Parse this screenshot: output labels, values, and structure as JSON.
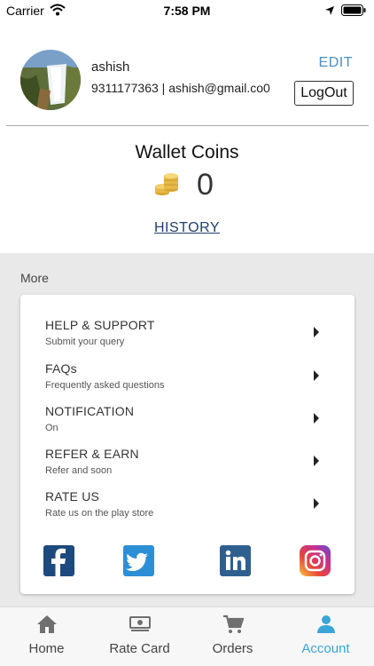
{
  "status_bar": {
    "carrier": "Carrier",
    "time": "7:58 PM"
  },
  "profile": {
    "name": "ashish",
    "contact": "9311177363 | ashish@gmail.co0",
    "edit_label": "EDIT",
    "logout_label": "LogOut"
  },
  "wallet": {
    "title": "Wallet Coins",
    "value": "0",
    "history_label": "HISTORY"
  },
  "more": {
    "label": "More",
    "items": [
      {
        "title": "HELP & SUPPORT",
        "subtitle": "Submit your query"
      },
      {
        "title": "FAQs",
        "subtitle": "Frequently asked questions"
      },
      {
        "title": "NOTIFICATION",
        "subtitle": "On"
      },
      {
        "title": "REFER & EARN",
        "subtitle": "Refer and soon"
      },
      {
        "title": "RATE US",
        "subtitle": "Rate us on the play store"
      }
    ],
    "social": [
      "facebook-icon",
      "twitter-icon",
      "linkedin-icon",
      "instagram-icon"
    ]
  },
  "tabs": [
    {
      "label": "Home",
      "icon": "home-icon"
    },
    {
      "label": "Rate Card",
      "icon": "rate-card-icon"
    },
    {
      "label": "Orders",
      "icon": "cart-icon"
    },
    {
      "label": "Account",
      "icon": "account-icon",
      "active": true
    }
  ],
  "colors": {
    "accent": "#3aa6d8",
    "edit": "#4a90c2",
    "history": "#1f3f6e",
    "section_bg": "#e9e9e9"
  }
}
